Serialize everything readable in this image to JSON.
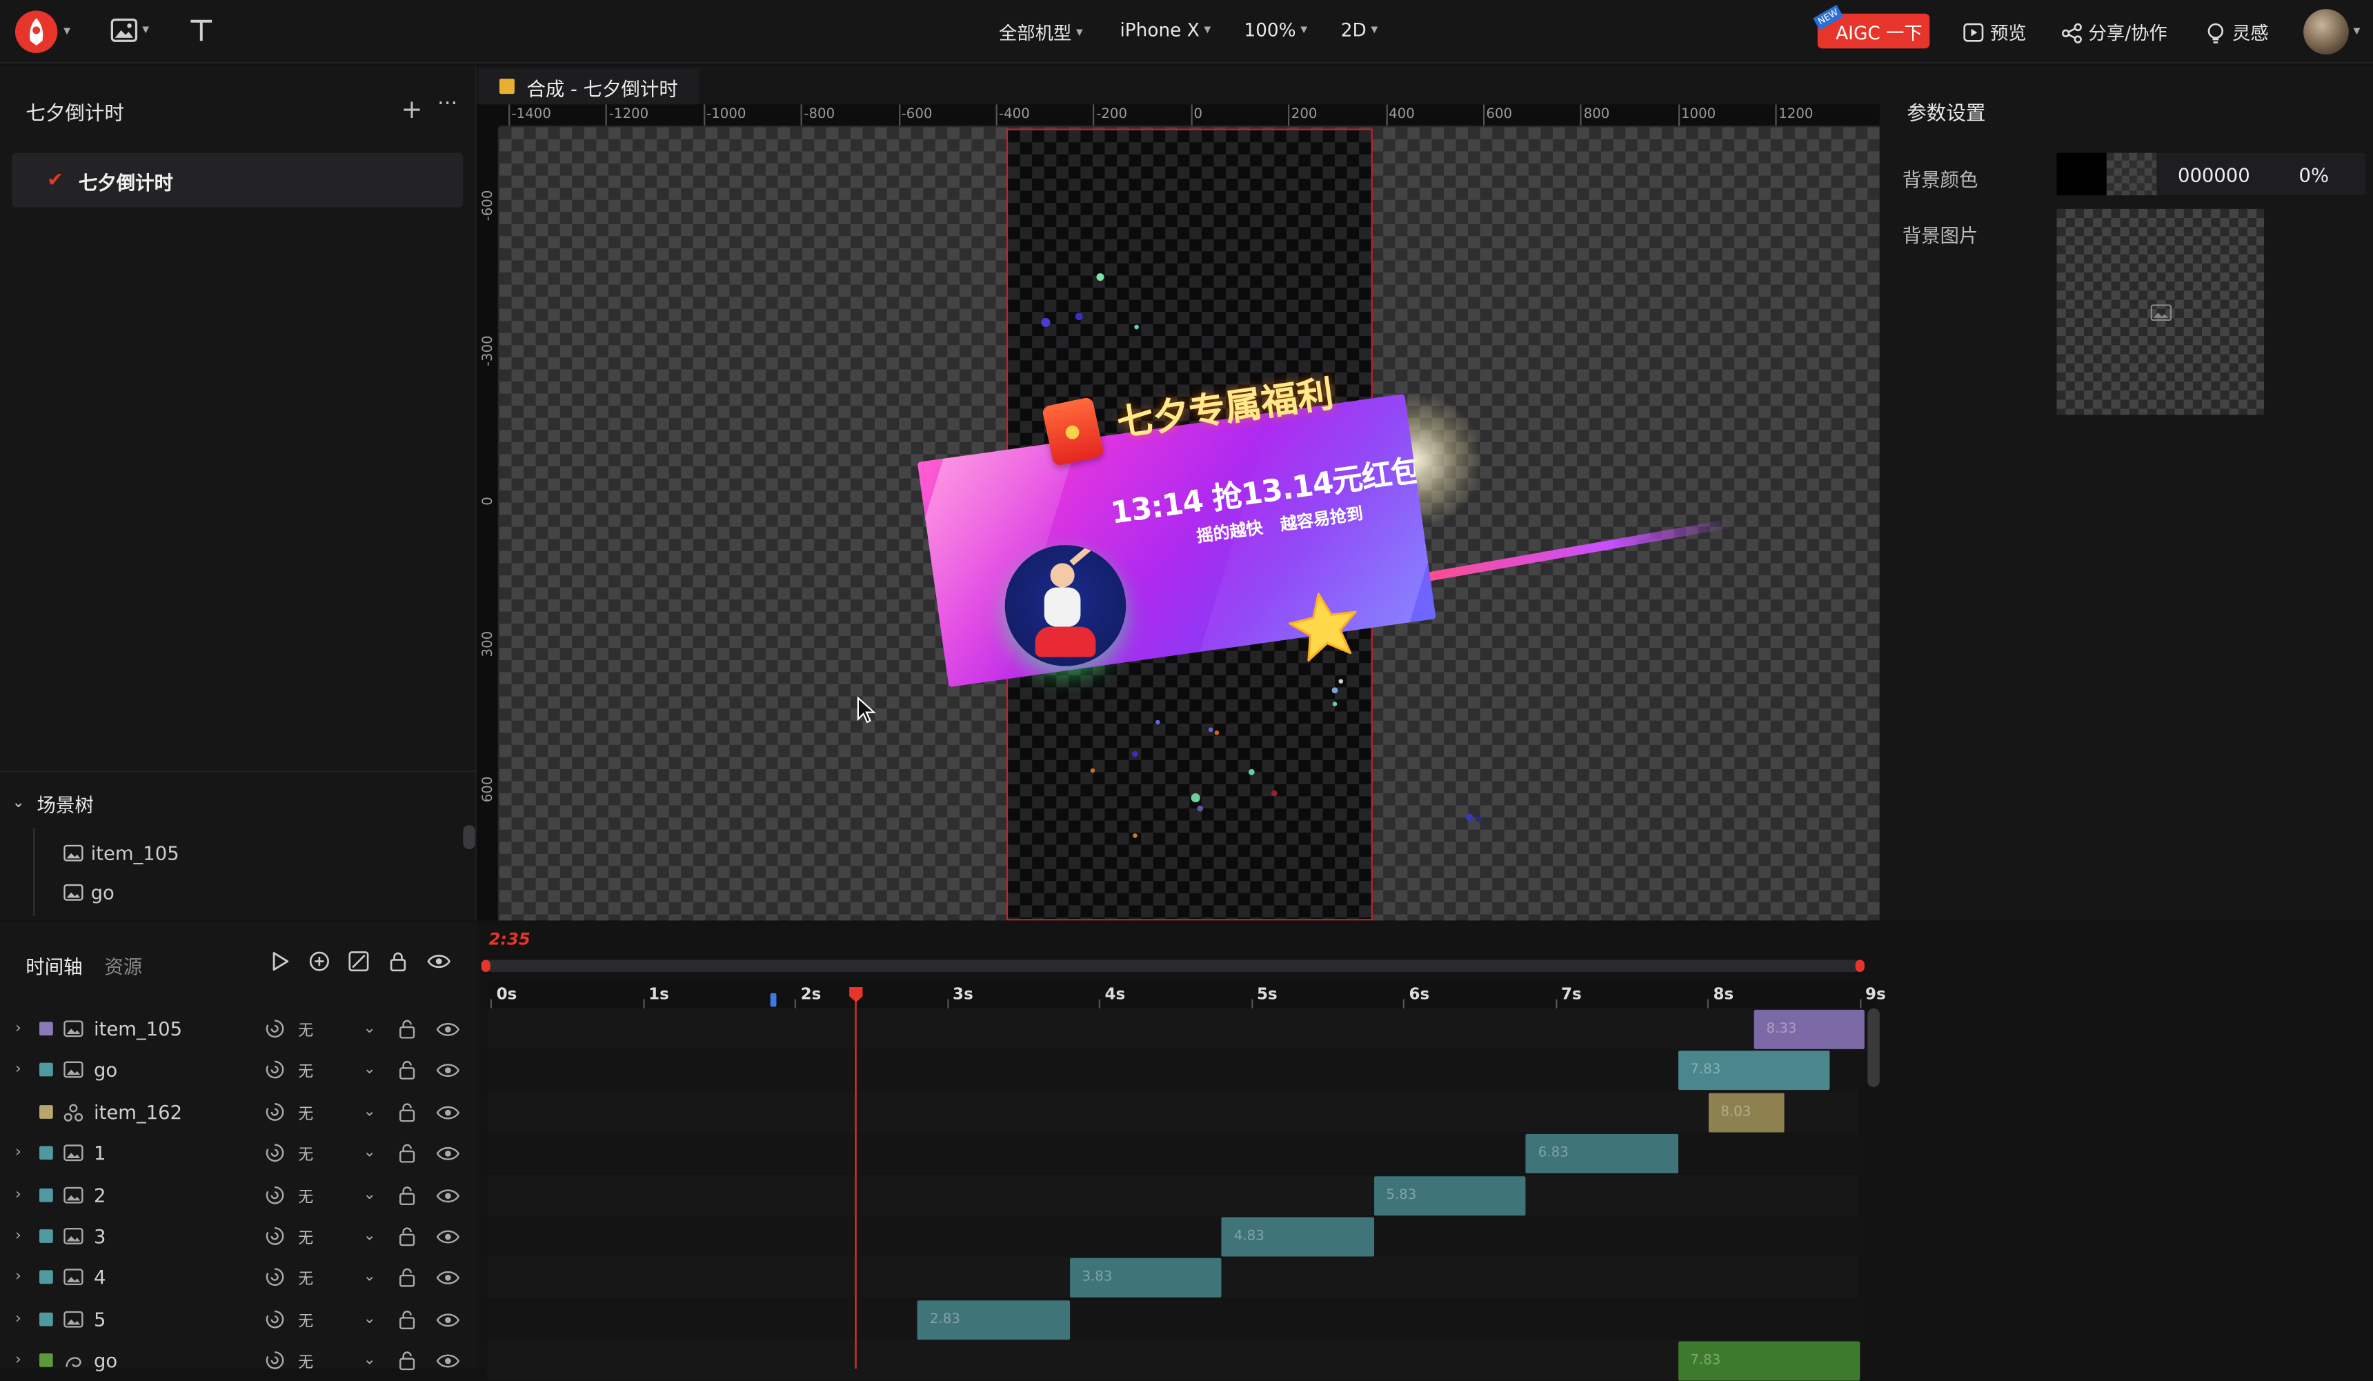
{
  "topbar": {
    "tools": [
      "logo-menu",
      "image-tool",
      "text-tool"
    ],
    "device_group": "全部机型",
    "device": "iPhone X",
    "zoom": "100%",
    "mode": "2D",
    "aigc_label": "AIGC 一下",
    "aigc_badge": "NEW",
    "preview": "预览",
    "share": "分享/协作",
    "inspiration": "灵感"
  },
  "left_panel": {
    "project_title": "七夕倒计时",
    "compositions": [
      {
        "label": "七夕倒计时",
        "checked": true
      }
    ],
    "scene_tree_title": "场景树",
    "scene_tree": [
      {
        "label": "item_105"
      },
      {
        "label": "go"
      }
    ]
  },
  "canvas": {
    "tab_label": "合成 - 七夕倒计时",
    "ruler_h": [
      "-1400",
      "-1200",
      "-1000",
      "-800",
      "-600",
      "-400",
      "-200",
      "0",
      "200",
      "400",
      "600",
      "800",
      "1000",
      "1200"
    ],
    "ruler_v": [
      "-600",
      "-300",
      "0",
      "300",
      "600"
    ],
    "banner": {
      "title": "七夕专属福利",
      "subtitle": "13:14 抢13.14元红包",
      "tagline": "摇的越快 越容易抢到"
    }
  },
  "params": {
    "title": "参数设置",
    "bg_color_label": "背景颜色",
    "bg_color_value": "000000",
    "bg_opacity": "0%",
    "bg_image_label": "背景图片"
  },
  "timeline": {
    "tab_timeline": "时间轴",
    "tab_assets": "资源",
    "current_time": "2:35",
    "playhead_seconds": 2.35,
    "ruler": [
      "0s",
      "1s",
      "2s",
      "3s",
      "4s",
      "5s",
      "6s",
      "7s",
      "8s",
      "9s"
    ],
    "none_label": "无",
    "layers": [
      {
        "name": "item_105",
        "color": "#8c7ab8",
        "type": "image",
        "expand": true
      },
      {
        "name": "go",
        "color": "#4f9aa0",
        "type": "image",
        "expand": true
      },
      {
        "name": "item_162",
        "color": "#b8a66a",
        "type": "group",
        "expand": false
      },
      {
        "name": "1",
        "color": "#4f9aa0",
        "type": "image",
        "expand": true
      },
      {
        "name": "2",
        "color": "#4f9aa0",
        "type": "image",
        "expand": true
      },
      {
        "name": "3",
        "color": "#4f9aa0",
        "type": "image",
        "expand": true
      },
      {
        "name": "4",
        "color": "#4f9aa0",
        "type": "image",
        "expand": true
      },
      {
        "name": "5",
        "color": "#4f9aa0",
        "type": "image",
        "expand": true
      },
      {
        "name": "go",
        "color": "#5a9a3a",
        "type": "spin",
        "expand": true
      }
    ],
    "clips": [
      {
        "start": 8.25,
        "end": 9.2,
        "color": "#7b6aa6",
        "label": "8.33"
      },
      {
        "start": 7.75,
        "end": 8.75,
        "color": "#4a868c",
        "label": "7.83"
      },
      {
        "start": 7.95,
        "end": 8.45,
        "color": "#8e8150",
        "label": "8.03"
      },
      {
        "start": 6.75,
        "end": 7.75,
        "color": "#3f7479",
        "label": "6.83"
      },
      {
        "start": 5.75,
        "end": 6.75,
        "color": "#3f7479",
        "label": "5.83"
      },
      {
        "start": 4.75,
        "end": 5.75,
        "color": "#3f7479",
        "label": "4.83"
      },
      {
        "start": 3.75,
        "end": 4.75,
        "color": "#3f7479",
        "label": "3.83"
      },
      {
        "start": 2.75,
        "end": 3.75,
        "color": "#3f7479",
        "label": "2.83"
      },
      {
        "start": 7.75,
        "end": 8.95,
        "color": "#3e7a2c",
        "label": "7.83"
      }
    ]
  }
}
